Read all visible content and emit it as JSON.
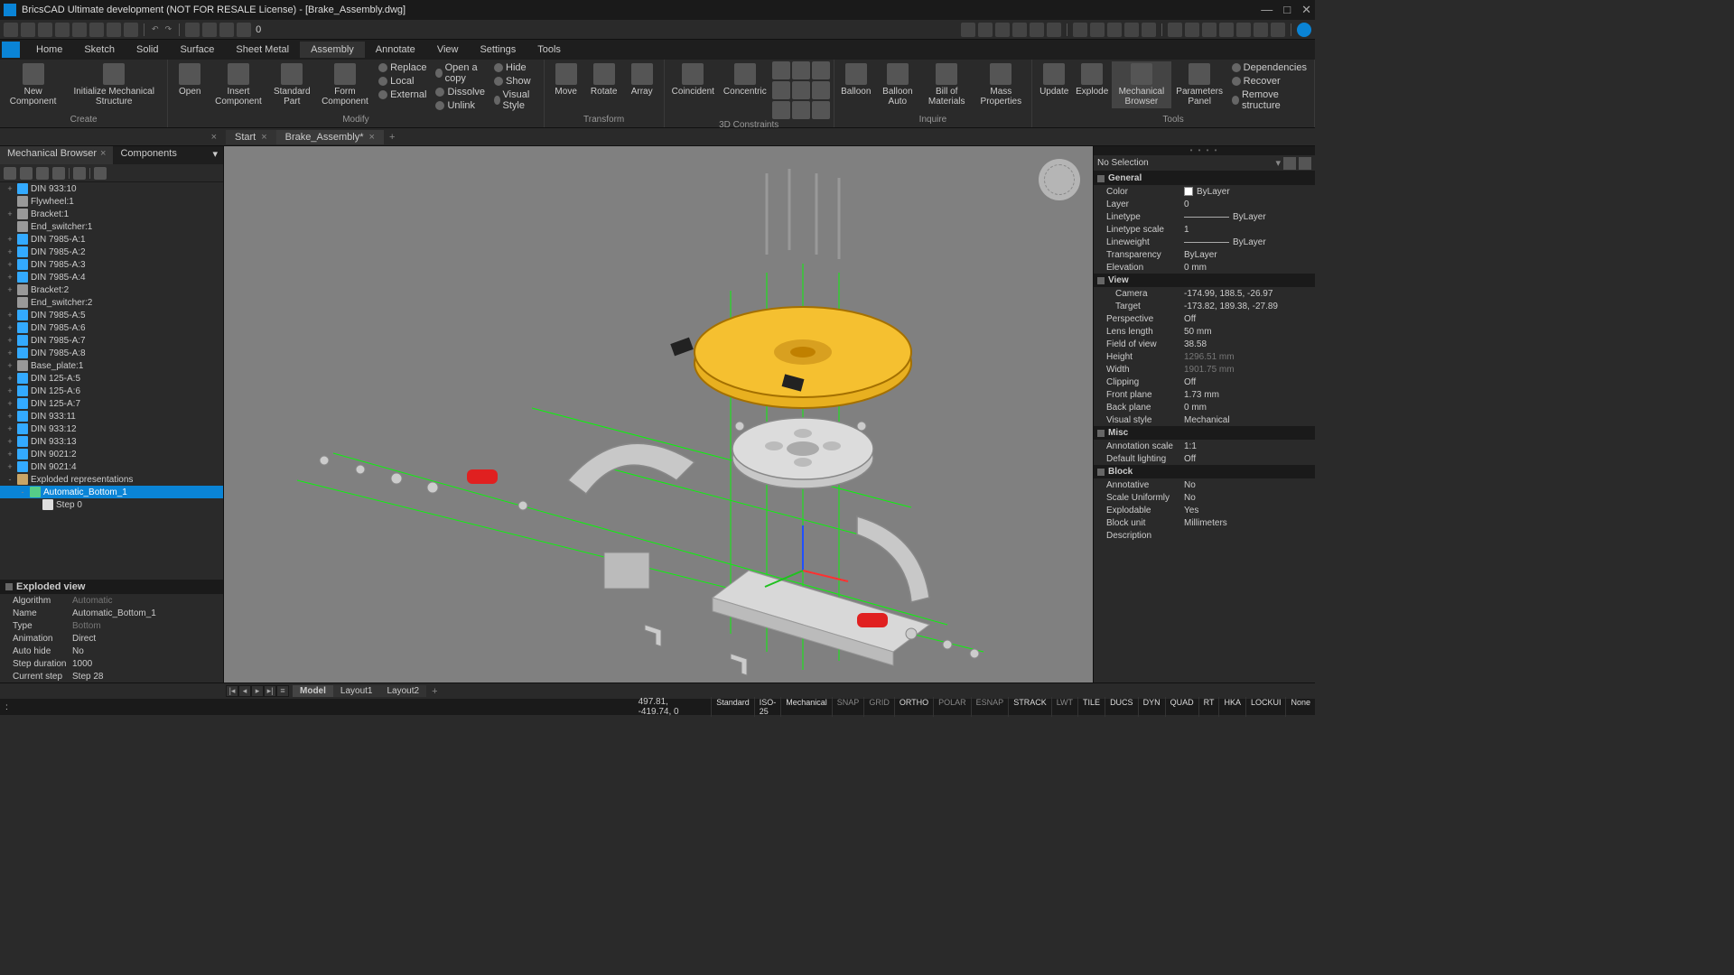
{
  "title": "BricsCAD Ultimate development (NOT FOR RESALE License) - [Brake_Assembly.dwg]",
  "qat_number": "0",
  "menubar": [
    "Home",
    "Sketch",
    "Solid",
    "Surface",
    "Sheet Metal",
    "Assembly",
    "Annotate",
    "View",
    "Settings",
    "Tools"
  ],
  "menubar_active": 5,
  "ribbon": {
    "create": {
      "label": "Create",
      "new_component": "New\nComponent",
      "init": "Initialize Mechanical\nStructure"
    },
    "open_panel": {
      "open": "Open",
      "insert": "Insert\nComponent",
      "standard": "Standard\nPart",
      "form": "Form\nComponent"
    },
    "modify": {
      "label": "Modify",
      "replace": "Replace",
      "local": "Local",
      "external": "External",
      "open_copy": "Open a copy",
      "dissolve": "Dissolve",
      "unlink": "Unlink",
      "hide": "Hide",
      "show": "Show",
      "visual": "Visual Style"
    },
    "transform": {
      "label": "Transform",
      "move": "Move",
      "rotate": "Rotate",
      "array": "Array"
    },
    "constraints": {
      "label": "3D Constraints",
      "coincident": "Coincident",
      "concentric": "Concentric"
    },
    "inquire": {
      "label": "Inquire",
      "balloon": "Balloon",
      "balloon_auto": "Balloon\nAuto",
      "bom": "Bill of\nMaterials",
      "mass": "Mass\nProperties"
    },
    "mb": {
      "update": "Update",
      "explode": "Explode",
      "mech_browser": "Mechanical\nBrowser",
      "param_panel": "Parameters\nPanel"
    },
    "tools": {
      "label": "Tools",
      "deps": "Dependencies",
      "recover": "Recover",
      "remove": "Remove structure"
    }
  },
  "doctabs": {
    "start": "Start",
    "file": "Brake_Assembly*"
  },
  "left_panel": {
    "tab1": "Mechanical Browser",
    "tab2": "Components",
    "tree": [
      {
        "exp": "+",
        "ico": "cyl",
        "lbl": "DIN 933:10",
        "i": 0
      },
      {
        "exp": "",
        "ico": "box",
        "lbl": "Flywheel:1",
        "i": 0
      },
      {
        "exp": "+",
        "ico": "box",
        "lbl": "Bracket:1",
        "i": 0
      },
      {
        "exp": "",
        "ico": "box",
        "lbl": "End_switcher:1",
        "i": 0
      },
      {
        "exp": "+",
        "ico": "cyl",
        "lbl": "DIN 7985-A:1",
        "i": 0
      },
      {
        "exp": "+",
        "ico": "cyl",
        "lbl": "DIN 7985-A:2",
        "i": 0
      },
      {
        "exp": "+",
        "ico": "cyl",
        "lbl": "DIN 7985-A:3",
        "i": 0
      },
      {
        "exp": "+",
        "ico": "cyl",
        "lbl": "DIN 7985-A:4",
        "i": 0
      },
      {
        "exp": "+",
        "ico": "box",
        "lbl": "Bracket:2",
        "i": 0
      },
      {
        "exp": "",
        "ico": "box",
        "lbl": "End_switcher:2",
        "i": 0
      },
      {
        "exp": "+",
        "ico": "cyl",
        "lbl": "DIN 7985-A:5",
        "i": 0
      },
      {
        "exp": "+",
        "ico": "cyl",
        "lbl": "DIN 7985-A:6",
        "i": 0
      },
      {
        "exp": "+",
        "ico": "cyl",
        "lbl": "DIN 7985-A:7",
        "i": 0
      },
      {
        "exp": "+",
        "ico": "cyl",
        "lbl": "DIN 7985-A:8",
        "i": 0
      },
      {
        "exp": "+",
        "ico": "box",
        "lbl": "Base_plate:1",
        "i": 0
      },
      {
        "exp": "+",
        "ico": "cyl",
        "lbl": "DIN 125-A:5",
        "i": 0
      },
      {
        "exp": "+",
        "ico": "cyl",
        "lbl": "DIN 125-A:6",
        "i": 0
      },
      {
        "exp": "+",
        "ico": "cyl",
        "lbl": "DIN 125-A:7",
        "i": 0
      },
      {
        "exp": "+",
        "ico": "cyl",
        "lbl": "DIN 933:11",
        "i": 0
      },
      {
        "exp": "+",
        "ico": "cyl",
        "lbl": "DIN 933:12",
        "i": 0
      },
      {
        "exp": "+",
        "ico": "cyl",
        "lbl": "DIN 933:13",
        "i": 0
      },
      {
        "exp": "+",
        "ico": "cyl",
        "lbl": "DIN 9021:2",
        "i": 0
      },
      {
        "exp": "+",
        "ico": "cyl",
        "lbl": "DIN 9021:4",
        "i": 0
      },
      {
        "exp": "-",
        "ico": "folder",
        "lbl": "Exploded representations",
        "i": 0
      },
      {
        "exp": "-",
        "ico": "exp2",
        "lbl": "Automatic_Bottom_1",
        "i": 1,
        "sel": true
      },
      {
        "exp": "",
        "ico": "step",
        "lbl": "Step 0",
        "i": 2
      }
    ],
    "exploded_hdr": "Exploded view",
    "props": [
      {
        "k": "Algorithm",
        "v": "Automatic",
        "dim": true
      },
      {
        "k": "Name",
        "v": "Automatic_Bottom_1"
      },
      {
        "k": "Type",
        "v": "Bottom",
        "dim": true
      },
      {
        "k": "Animation",
        "v": "Direct"
      },
      {
        "k": "Auto hide",
        "v": "No"
      },
      {
        "k": "Step duration",
        "v": "1000"
      },
      {
        "k": "Current step",
        "v": "Step 28"
      }
    ]
  },
  "right_panel": {
    "selection": "No Selection",
    "groups": [
      {
        "hdr": "General",
        "rows": [
          {
            "k": "Color",
            "v": "ByLayer",
            "sw": true
          },
          {
            "k": "Layer",
            "v": "0"
          },
          {
            "k": "Linetype",
            "v": "ByLayer",
            "line": true
          },
          {
            "k": "Linetype scale",
            "v": "1"
          },
          {
            "k": "Lineweight",
            "v": "ByLayer",
            "line": true
          },
          {
            "k": "Transparency",
            "v": "ByLayer"
          },
          {
            "k": "Elevation",
            "v": "0 mm"
          }
        ]
      },
      {
        "hdr": "View",
        "rows": [
          {
            "k": "Camera",
            "v": "-174.99, 188.5, -26.97",
            "sub": true
          },
          {
            "k": "Target",
            "v": "-173.82, 189.38, -27.89",
            "sub": true
          },
          {
            "k": "Perspective",
            "v": "Off"
          },
          {
            "k": "Lens length",
            "v": "50 mm"
          },
          {
            "k": "Field of view",
            "v": "38.58"
          },
          {
            "k": "Height",
            "v": "1296.51 mm",
            "dim": true
          },
          {
            "k": "Width",
            "v": "1901.75 mm",
            "dim": true
          },
          {
            "k": "Clipping",
            "v": "Off"
          },
          {
            "k": "Front plane",
            "v": "1.73 mm"
          },
          {
            "k": "Back plane",
            "v": "0 mm"
          },
          {
            "k": "Visual style",
            "v": "Mechanical"
          }
        ]
      },
      {
        "hdr": "Misc",
        "rows": [
          {
            "k": "Annotation scale",
            "v": "1:1"
          },
          {
            "k": "Default lighting",
            "v": "Off"
          }
        ]
      },
      {
        "hdr": "Block",
        "rows": [
          {
            "k": "Annotative",
            "v": "No"
          },
          {
            "k": "Scale Uniformly",
            "v": "No"
          },
          {
            "k": "Explodable",
            "v": "Yes"
          },
          {
            "k": "Block unit",
            "v": "Millimeters"
          },
          {
            "k": "Description",
            "v": ""
          }
        ]
      }
    ]
  },
  "modeltabs": [
    "Model",
    "Layout1",
    "Layout2"
  ],
  "status": {
    "cmd": ":",
    "coords": "497.81, -419.74, 0",
    "cells": [
      {
        "t": "Standard",
        "on": true
      },
      {
        "t": "ISO-25",
        "on": true
      },
      {
        "t": "Mechanical",
        "on": true
      },
      {
        "t": "SNAP"
      },
      {
        "t": "GRID"
      },
      {
        "t": "ORTHO",
        "on": true
      },
      {
        "t": "POLAR"
      },
      {
        "t": "ESNAP"
      },
      {
        "t": "STRACK",
        "on": true
      },
      {
        "t": "LWT"
      },
      {
        "t": "TILE",
        "on": true
      },
      {
        "t": "DUCS",
        "on": true
      },
      {
        "t": "DYN",
        "on": true
      },
      {
        "t": "QUAD",
        "on": true
      },
      {
        "t": "RT",
        "on": true
      },
      {
        "t": "HKA",
        "on": true
      },
      {
        "t": "LOCKUI",
        "on": true
      },
      {
        "t": "None",
        "on": true
      }
    ]
  }
}
